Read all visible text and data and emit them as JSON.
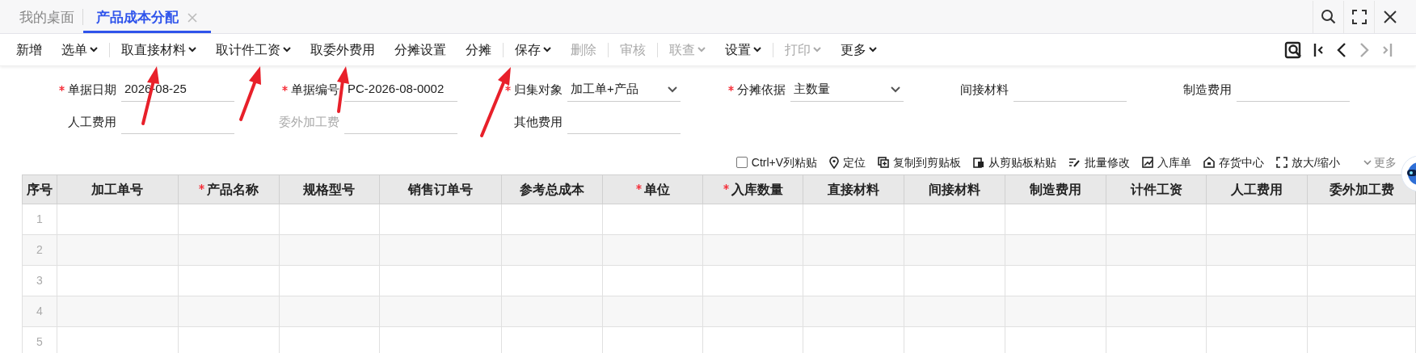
{
  "tabs": [
    {
      "label": "我的桌面",
      "selected": false,
      "closable": false
    },
    {
      "label": "产品成本分配",
      "selected": true,
      "closable": true
    }
  ],
  "toolbar": [
    {
      "label": "新增",
      "dropdown": false,
      "disabled": false,
      "separator_before": false
    },
    {
      "label": "选单",
      "dropdown": true,
      "disabled": false,
      "separator_before": false
    },
    {
      "label": "取直接材料",
      "dropdown": true,
      "disabled": false,
      "separator_before": true
    },
    {
      "label": "取计件工资",
      "dropdown": true,
      "disabled": false,
      "separator_before": false
    },
    {
      "label": "取委外费用",
      "dropdown": false,
      "disabled": false,
      "separator_before": false
    },
    {
      "label": "分摊设置",
      "dropdown": false,
      "disabled": false,
      "separator_before": false
    },
    {
      "label": "分摊",
      "dropdown": false,
      "disabled": false,
      "separator_before": false
    },
    {
      "label": "保存",
      "dropdown": true,
      "disabled": false,
      "separator_before": true
    },
    {
      "label": "删除",
      "dropdown": false,
      "disabled": true,
      "separator_before": false
    },
    {
      "label": "审核",
      "dropdown": false,
      "disabled": true,
      "separator_before": true
    },
    {
      "label": "联查",
      "dropdown": true,
      "disabled": true,
      "separator_before": true
    },
    {
      "label": "设置",
      "dropdown": true,
      "disabled": false,
      "separator_before": false
    },
    {
      "label": "打印",
      "dropdown": true,
      "disabled": true,
      "separator_before": true
    },
    {
      "label": "更多",
      "dropdown": true,
      "disabled": false,
      "separator_before": false
    }
  ],
  "record_nav": [
    {
      "disabled": false
    },
    {
      "disabled": false
    },
    {
      "disabled": false
    },
    {
      "disabled": true
    },
    {
      "disabled": true
    }
  ],
  "form_rows": [
    [
      {
        "label": "单据日期",
        "required": true,
        "disabled": false,
        "kind": "input",
        "value": "2026-08-25"
      },
      {
        "label": "单据编号",
        "required": true,
        "disabled": false,
        "kind": "input",
        "value": "PC-2026-08-0002"
      },
      {
        "label": "归集对象",
        "required": true,
        "disabled": false,
        "kind": "select",
        "value": "加工单+产品"
      },
      {
        "label": "分摊依据",
        "required": true,
        "disabled": false,
        "kind": "select",
        "value": "主数量"
      },
      {
        "label": "间接材料",
        "required": false,
        "disabled": false,
        "kind": "input"
      },
      {
        "label": "制造费用",
        "required": false,
        "disabled": false,
        "kind": "input"
      }
    ],
    [
      {
        "label": "人工费用",
        "required": false,
        "disabled": false,
        "kind": "input"
      },
      {
        "label": "委外加工费",
        "required": false,
        "disabled": true,
        "kind": "input"
      },
      {
        "label": "其他费用",
        "required": false,
        "disabled": false,
        "kind": "input"
      }
    ]
  ],
  "grid_toolbar": [
    {
      "kind": "checkbox",
      "label": "Ctrl+V列粘贴",
      "checked": false
    },
    {
      "kind": "action",
      "label": "定位"
    },
    {
      "kind": "action",
      "label": "复制到剪贴板"
    },
    {
      "kind": "action",
      "label": "从剪贴板粘贴"
    },
    {
      "kind": "action",
      "label": "批量修改"
    },
    {
      "kind": "action",
      "label": "入库单"
    },
    {
      "kind": "action",
      "label": "存货中心"
    },
    {
      "kind": "action",
      "label": "放大/缩小"
    },
    {
      "kind": "more",
      "label": "更多"
    }
  ],
  "table": {
    "columns": [
      {
        "label": "序号",
        "required": false
      },
      {
        "label": "加工单号",
        "required": false
      },
      {
        "label": "产品名称",
        "required": true
      },
      {
        "label": "规格型号",
        "required": false
      },
      {
        "label": "销售订单号",
        "required": false
      },
      {
        "label": "参考总成本",
        "required": false
      },
      {
        "label": "单位",
        "required": true
      },
      {
        "label": "入库数量",
        "required": true
      },
      {
        "label": "直接材料",
        "required": false
      },
      {
        "label": "间接材料",
        "required": false
      },
      {
        "label": "制造费用",
        "required": false
      },
      {
        "label": "计件工资",
        "required": false
      },
      {
        "label": "人工费用",
        "required": false
      },
      {
        "label": "委外加工费",
        "required": false
      }
    ],
    "rows": [
      {
        "index": "1"
      },
      {
        "index": "2"
      },
      {
        "index": "3"
      },
      {
        "index": "4"
      },
      {
        "index": "5"
      }
    ]
  }
}
